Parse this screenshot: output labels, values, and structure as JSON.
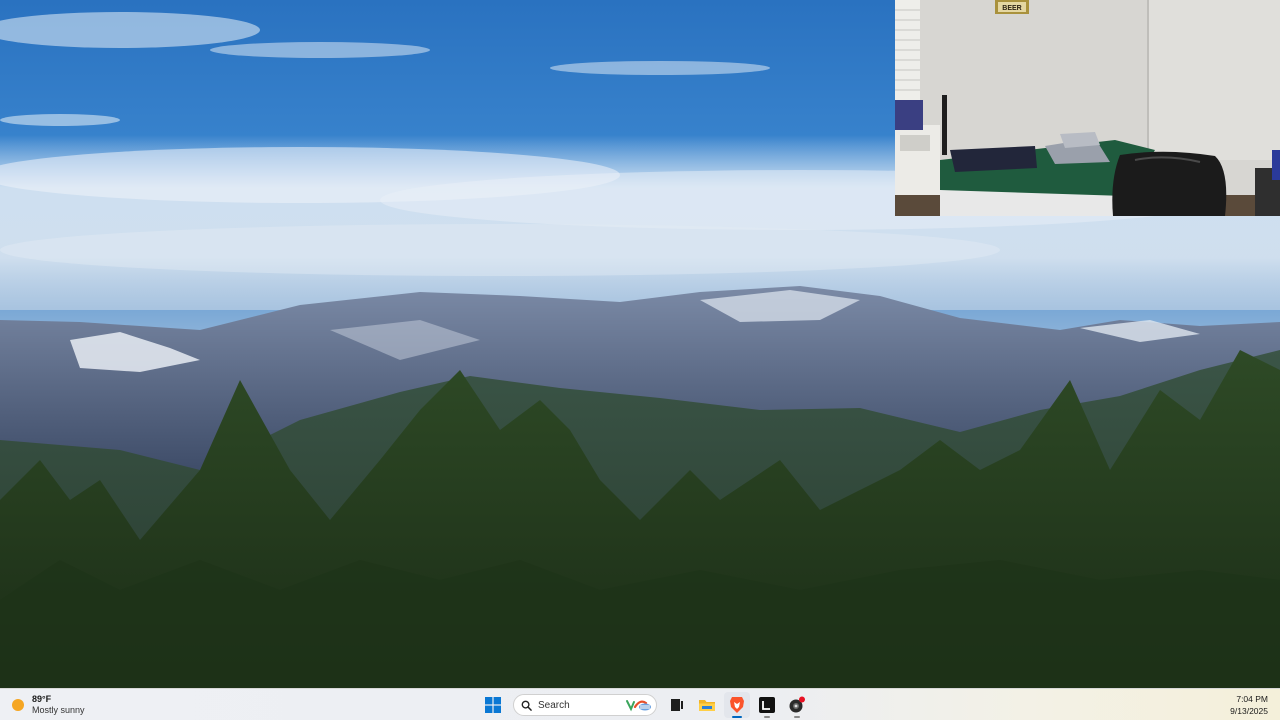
{
  "wallpaper": {
    "description_icon": "mountain-forest-landscape",
    "colors": {
      "sky": "#2f78c4",
      "mountain": "#3a4a66",
      "trees": "#1f3a1f"
    }
  },
  "webcam": {
    "sign_text": "BEER",
    "colors": {
      "wall": "#d6d5d1",
      "bed": "#1f5a3c",
      "chair": "#1c1c1c"
    }
  },
  "taskbar": {
    "weather": {
      "icon": "partly-sunny-icon",
      "temperature": "89°F",
      "condition": "Mostly sunny"
    },
    "search": {
      "label": "Search"
    },
    "apps": [
      {
        "name": "windows-start",
        "icon": "windows-logo-icon"
      },
      {
        "name": "task-view",
        "icon": "task-view-icon"
      },
      {
        "name": "file-explorer",
        "icon": "folder-icon"
      },
      {
        "name": "brave-browser",
        "icon": "brave-lion-icon"
      },
      {
        "name": "terminal",
        "icon": "terminal-icon"
      },
      {
        "name": "obs-studio",
        "icon": "record-icon"
      }
    ],
    "clock": {
      "time": "7:04 PM",
      "date": "9/13/2025"
    },
    "colors": {
      "accent": "#0067c0",
      "brave": "#fb542b"
    }
  }
}
